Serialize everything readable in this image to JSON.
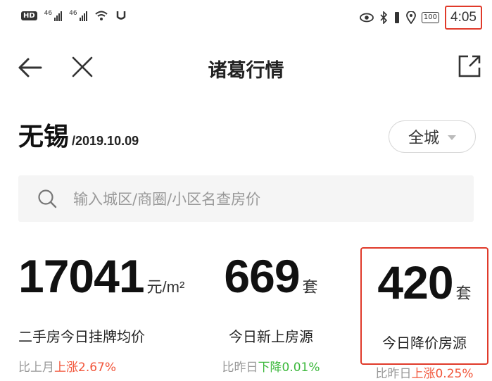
{
  "status_bar": {
    "hd": "HD",
    "sig1": "46",
    "sig2": "46",
    "battery": "100",
    "time": "4:05"
  },
  "nav": {
    "title": "诸葛行情"
  },
  "city": {
    "name": "无锡",
    "date": "/2019.10.09",
    "scope": "全城"
  },
  "search": {
    "placeholder": "输入城区/商圈/小区名查房价"
  },
  "stats": [
    {
      "value": "17041",
      "unit": "元/m²",
      "label": "二手房今日挂牌均价",
      "compare": "比上月",
      "change": "上涨2.67%"
    },
    {
      "value": "669",
      "unit": "套",
      "label": "今日新上房源",
      "compare": "比昨日",
      "change": "下降0.01%"
    },
    {
      "value": "420",
      "unit": "套",
      "label": "今日降价房源",
      "compare": "比昨日",
      "change": "上涨0.25%"
    }
  ],
  "colors": {
    "up": "#f2553a",
    "down": "#3cb83c",
    "highlight": "#e03a2a"
  }
}
